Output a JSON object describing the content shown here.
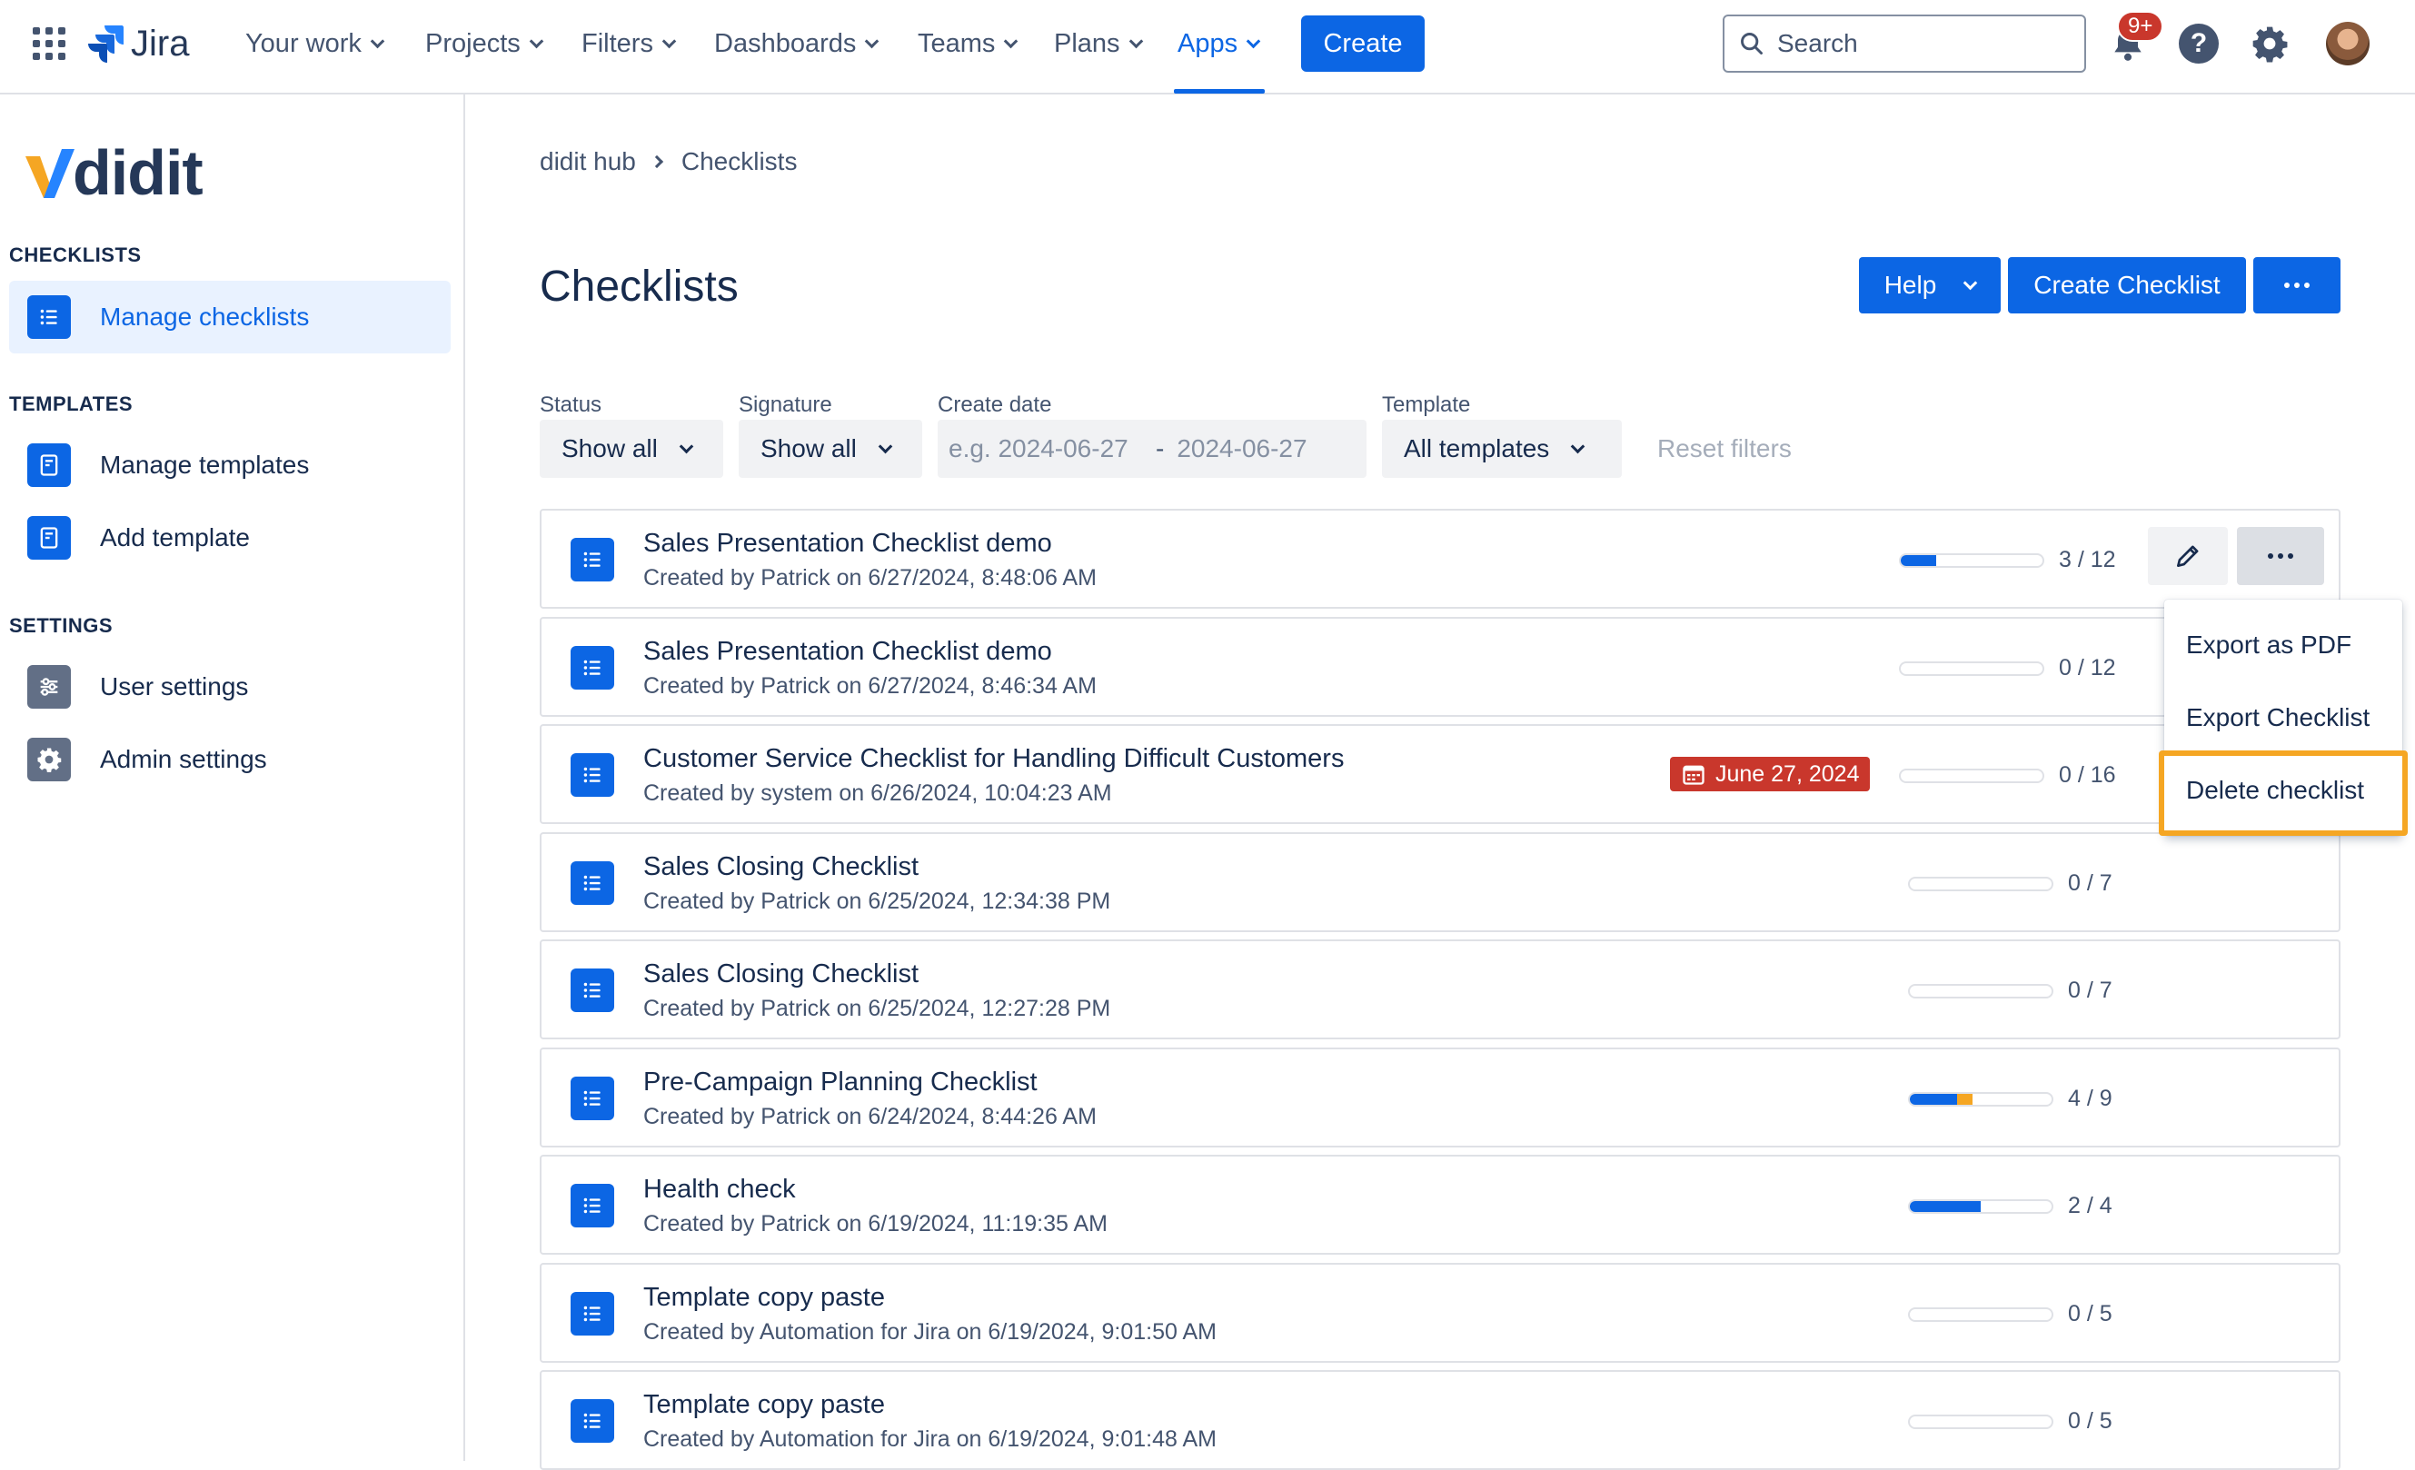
{
  "topnav": {
    "brand": "Jira",
    "items": [
      {
        "label": "Your work"
      },
      {
        "label": "Projects"
      },
      {
        "label": "Filters"
      },
      {
        "label": "Dashboards"
      },
      {
        "label": "Teams"
      },
      {
        "label": "Plans"
      },
      {
        "label": "Apps",
        "active": true
      }
    ],
    "create_label": "Create",
    "search_placeholder": "Search",
    "notification_badge": "9+",
    "accent": "#0c66e4"
  },
  "sidebar": {
    "brand": "didit",
    "sections": [
      {
        "heading": "CHECKLISTS",
        "items": [
          {
            "label": "Manage checklists",
            "icon": "list-icon",
            "active": true
          }
        ]
      },
      {
        "heading": "TEMPLATES",
        "items": [
          {
            "label": "Manage templates",
            "icon": "document-icon"
          },
          {
            "label": "Add template",
            "icon": "document-icon"
          }
        ]
      },
      {
        "heading": "SETTINGS",
        "items": [
          {
            "label": "User settings",
            "icon": "sliders-icon"
          },
          {
            "label": "Admin settings",
            "icon": "gear-icon"
          }
        ]
      }
    ]
  },
  "breadcrumb": [
    "didit hub",
    "Checklists"
  ],
  "page": {
    "title": "Checklists",
    "help_label": "Help",
    "create_label": "Create Checklist"
  },
  "filters": {
    "status": {
      "label": "Status",
      "value": "Show all"
    },
    "signature": {
      "label": "Signature",
      "value": "Show all"
    },
    "create_date": {
      "label": "Create date",
      "from_placeholder": "e.g. 2024-06-27",
      "separator": "-",
      "to_placeholder": "2024-06-27"
    },
    "template": {
      "label": "Template",
      "value": "All templates"
    },
    "reset_label": "Reset filters"
  },
  "checklists": [
    {
      "title": "Sales Presentation Checklist demo",
      "subtitle": "Created by Patrick on 6/27/2024, 8:48:06 AM",
      "count": "3 / 12",
      "done": 3,
      "warn": 0,
      "total": 12
    },
    {
      "title": "Sales Presentation Checklist demo",
      "subtitle": "Created by Patrick on 6/27/2024, 8:46:34 AM",
      "count": "0 / 12",
      "done": 0,
      "warn": 0,
      "total": 12
    },
    {
      "title": "Customer Service Checklist for Handling Difficult Customers",
      "subtitle": "Created by system on 6/26/2024, 10:04:23 AM",
      "count": "0 / 16",
      "done": 0,
      "warn": 0,
      "total": 16,
      "due": "June 27, 2024"
    },
    {
      "title": "Sales Closing Checklist",
      "subtitle": "Created by Patrick on 6/25/2024, 12:34:38 PM",
      "count": "0 / 7",
      "done": 0,
      "warn": 0,
      "total": 7
    },
    {
      "title": "Sales Closing Checklist",
      "subtitle": "Created by Patrick on 6/25/2024, 12:27:28 PM",
      "count": "0 / 7",
      "done": 0,
      "warn": 0,
      "total": 7
    },
    {
      "title": "Pre-Campaign Planning Checklist",
      "subtitle": "Created by Patrick on 6/24/2024, 8:44:26 AM",
      "count": "4 / 9",
      "done": 3,
      "warn": 1,
      "total": 9
    },
    {
      "title": "Health check",
      "subtitle": "Created by Patrick on 6/19/2024, 11:19:35 AM",
      "count": "2 / 4",
      "done": 2,
      "warn": 0,
      "total": 4
    },
    {
      "title": "Template copy paste",
      "subtitle": "Created by Automation for Jira on 6/19/2024, 9:01:50 AM",
      "count": "0 / 5",
      "done": 0,
      "warn": 0,
      "total": 5
    },
    {
      "title": "Template copy paste",
      "subtitle": "Created by Automation for Jira on 6/19/2024, 9:01:48 AM",
      "count": "0 / 5",
      "done": 0,
      "warn": 0,
      "total": 5
    }
  ],
  "dropdown": {
    "items": [
      {
        "label": "Export as PDF"
      },
      {
        "label": "Export Checklist"
      },
      {
        "label": "Delete checklist",
        "highlighted": true
      }
    ],
    "highlight_color": "#f5a623"
  }
}
